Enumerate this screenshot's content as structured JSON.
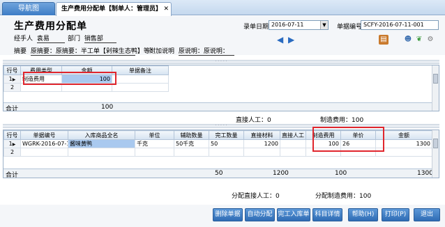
{
  "tabs": {
    "nav_label": "导航图",
    "active_label": "生产费用分配单【制单人：管理员】",
    "close_glyph": "✕"
  },
  "header": {
    "title": "生产费用分配单",
    "handler_label": "经手人",
    "handler_value": "袁易",
    "dept_label": "部门",
    "dept_value": "销售部",
    "summary_label": "摘要",
    "summary_text": "原摘要：原摘要：半工单【剁辣生态鸭】等：",
    "note_label": "附加说明",
    "note_text": "原说明：原说明：",
    "date_label": "录单日期",
    "date_value": "2016-07-11",
    "billno_label": "单据编号",
    "billno_value": "SCFY-2016-07-11-001"
  },
  "grid1": {
    "columns": [
      "行号",
      "费用类型",
      "金额",
      "单据备注"
    ],
    "rows": [
      {
        "num": "1",
        "type": "制造费用",
        "amount": "100",
        "note": ""
      },
      {
        "num": "2",
        "type": "",
        "amount": "",
        "note": ""
      }
    ],
    "total_label": "合计",
    "total_amount": "100"
  },
  "summary1": {
    "direct_labor": "直接人工：0",
    "manufacturing": "制造费用：100"
  },
  "grid2": {
    "columns": [
      "行号",
      "单据编号",
      "入库商品全名",
      "单位",
      "辅助数量",
      "完工数量",
      "直接材料",
      "直接人工",
      "制造费用",
      "单价",
      "金额"
    ],
    "rows": [
      {
        "num": "1",
        "billno": "WGRK-2016-07-11-0",
        "product": "酱味黄鸭",
        "unit": "千克",
        "aux_qty": "50千克",
        "qty": "50",
        "material": "1200",
        "labor": "",
        "mfg": "100",
        "price": "26",
        "amount": "1300"
      },
      {
        "num": "2",
        "billno": "",
        "product": "",
        "unit": "",
        "aux_qty": "",
        "qty": "",
        "material": "",
        "labor": "",
        "mfg": "",
        "price": "",
        "amount": ""
      }
    ],
    "total_label": "合计",
    "total_qty": "50",
    "total_material": "1200",
    "total_mfg": "100",
    "total_amount": "1300"
  },
  "summary2": {
    "alloc_labor": "分配直接人工：0",
    "alloc_mfg": "分配制造费用：100"
  },
  "buttons": {
    "delete_bill": "删除单据",
    "auto_alloc": "自动分配",
    "finished_in": "完工入库单",
    "subject_detail": "科目详情",
    "help": "帮助(H)",
    "print": "打印(P)",
    "exit": "退出"
  },
  "colors": {
    "accent": "#3d7dc6",
    "highlight": "#e0262d",
    "selected_cell": "#a9c9ef"
  }
}
